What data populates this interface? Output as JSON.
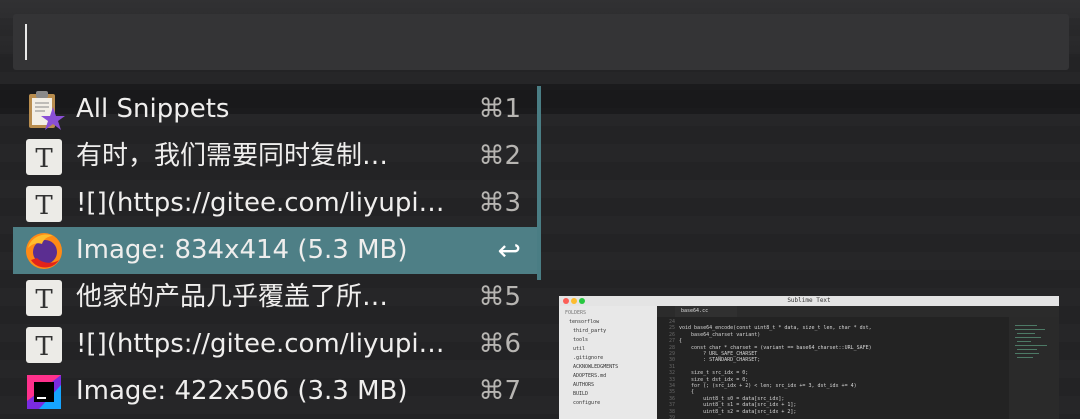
{
  "search": {
    "query": ""
  },
  "snippets": [
    {
      "title": "All Snippets",
      "shortcut": "⌘1",
      "icon": "clipboard-star-icon"
    },
    {
      "title": "有时，我们需要同时复制…",
      "shortcut": "⌘2",
      "icon": "text-t-icon"
    },
    {
      "title": "![](https://gitee.com/liyupi…",
      "shortcut": "⌘3",
      "icon": "text-t-icon"
    },
    {
      "title": "Image: 834x414 (5.3 MB)",
      "shortcut": "↩",
      "icon": "firefox-icon",
      "selected": true
    },
    {
      "title": "他家的产品几乎覆盖了所…",
      "shortcut": "⌘5",
      "icon": "text-t-icon"
    },
    {
      "title": "![](https://gitee.com/liyupi…",
      "shortcut": "⌘6",
      "icon": "text-t-icon"
    },
    {
      "title": "Image: 422x506 (3.3 MB)",
      "shortcut": "⌘7",
      "icon": "jetbrains-icon"
    }
  ],
  "preview": {
    "window_title": "Sublime Text",
    "tab": "base64.cc",
    "sidebar_header": "FOLDERS",
    "folders": [
      "tensorflow",
      "third_party",
      "tools",
      "util",
      ".gitignore",
      "ACKNOWLEDGMENTS",
      "ADOPTERS.md",
      "AUTHORS",
      "BUILD",
      "configure"
    ],
    "line_numbers": [
      "24",
      "25",
      "26",
      "27",
      "28",
      "29",
      "30",
      "31",
      "32",
      "33",
      "34",
      "35",
      "36",
      "37",
      "38",
      "39"
    ],
    "code_lines": [
      "",
      "void base64_encode(const uint8_t * data, size_t len, char * dst,",
      "    base64_charset variant)",
      "{",
      "    const char * charset = (variant == base64_charset::URL_SAFE)",
      "        ? URL_SAFE_CHARSET",
      "        : STANDARD_CHARSET;",
      "",
      "    size_t src_idx = 0;",
      "    size_t dst_idx = 0;",
      "    for (; (src_idx + 2) < len; src_idx += 3, dst_idx += 4)",
      "    {",
      "        uint8_t s0 = data[src_idx];",
      "        uint8_t s1 = data[src_idx + 1];",
      "        uint8_t s2 = data[src_idx + 2];",
      ""
    ]
  },
  "colors": {
    "selected_row": "#4e7f86",
    "search_bg": "#343436"
  }
}
